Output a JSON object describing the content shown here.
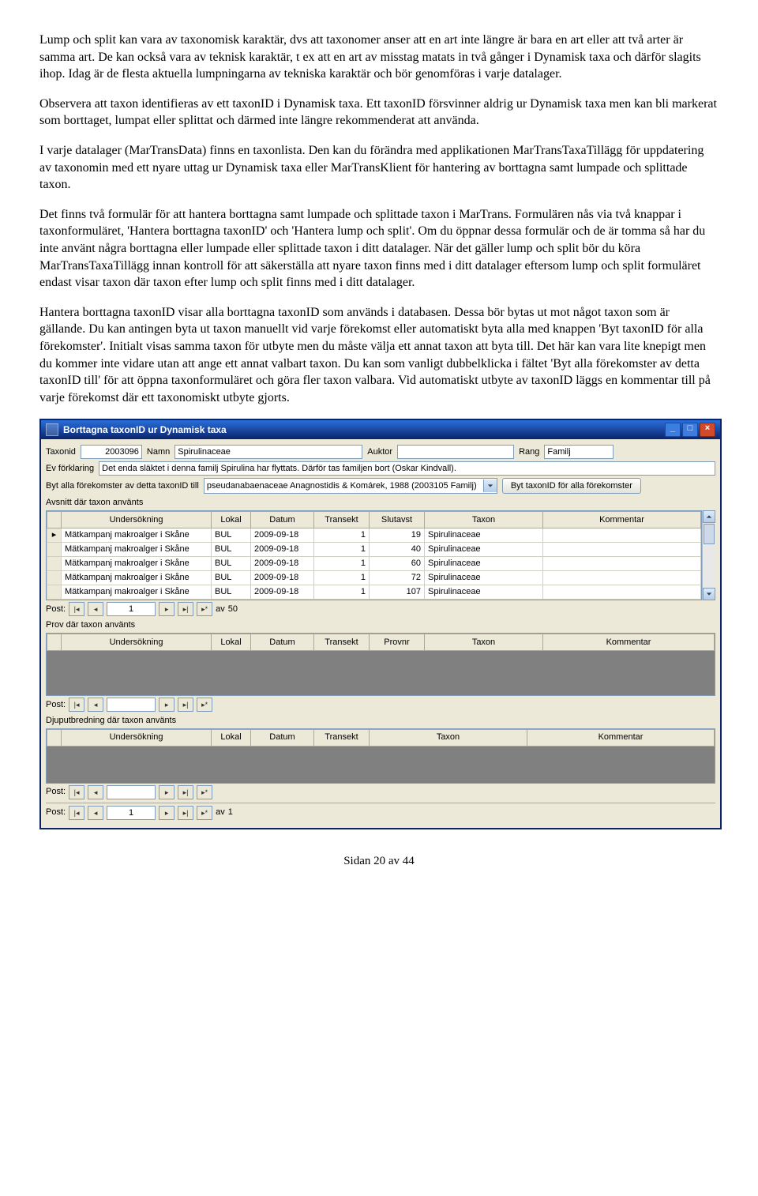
{
  "paragraphs": {
    "p1": "Lump och split kan vara av taxonomisk karaktär, dvs att taxonomer anser att en art inte längre är bara en art eller att två arter är samma art. De kan också vara av teknisk karaktär, t ex att en art av misstag matats in två gånger i Dynamisk taxa och därför slagits ihop. Idag är de flesta aktuella lumpningarna av tekniska karaktär och bör genomföras i varje datalager.",
    "p2": "Observera att taxon identifieras av ett taxonID i Dynamisk taxa. Ett taxonID försvinner aldrig ur Dynamisk taxa men kan bli markerat som borttaget, lumpat eller splittat och därmed inte längre rekommenderat att använda.",
    "p3": "I varje datalager (MarTransData) finns en taxonlista. Den kan du förändra med applikationen MarTransTaxaTillägg för uppdatering av taxonomin med ett nyare uttag ur Dynamisk taxa eller MarTransKlient för hantering av borttagna samt lumpade och splittade taxon.",
    "p4": "Det finns två formulär för att hantera borttagna samt lumpade och splittade taxon i MarTrans. Formulären nås via två knappar i taxonformuläret, 'Hantera borttagna taxonID' och 'Hantera lump och split'. Om du öppnar dessa formulär och de är tomma så har du inte använt några borttagna eller lumpade eller splittade taxon i ditt datalager. När det gäller lump och split bör du köra MarTransTaxaTillägg innan kontroll för att säkerställa att nyare taxon finns med i ditt datalager eftersom lump och split formuläret endast visar taxon där taxon efter lump och split finns med i ditt datalager.",
    "p5": "Hantera borttagna taxonID visar alla borttagna taxonID som används i databasen. Dessa bör bytas ut mot något taxon som är gällande. Du kan antingen byta ut taxon manuellt vid varje förekomst eller automatiskt byta alla med knappen 'Byt taxonID för alla förekomster'. Initialt visas samma taxon för utbyte men du måste välja ett annat taxon att byta till. Det här kan vara lite knepigt men du kommer inte vidare utan att ange ett annat valbart taxon. Du kan som vanligt dubbelklicka i fältet 'Byt alla förekomster av detta taxonID till' för att öppna taxonformuläret och göra fler taxon valbara. Vid automatiskt utbyte av taxonID läggs en kommentar till på varje förekomst där ett taxonomiskt utbyte gjorts."
  },
  "window": {
    "title": "Borttagna taxonID ur Dynamisk taxa",
    "labels": {
      "taxonid": "Taxonid",
      "namn": "Namn",
      "auktor": "Auktor",
      "rang": "Rang",
      "ev_forklaring": "Ev förklaring",
      "byt_alla": "Byt alla förekomster av detta taxonID till",
      "avsnitt": "Avsnitt där taxon använts",
      "prov": "Prov där taxon använts",
      "djup": "Djuputbredning där taxon använts",
      "post": "Post:",
      "av": "av"
    },
    "fields": {
      "taxonid": "2003096",
      "namn": "Spirulinaceae",
      "auktor": "",
      "rang": "Familj",
      "forklaring": "Det enda släktet i denna familj Spirulina har flyttats. Därför tas familjen bort (Oskar Kindvall).",
      "combo": "pseudanabaenaceae Anagnostidis & Komárek, 1988 (2003105 Familj)"
    },
    "buttons": {
      "byt": "Byt taxonID för alla förekomster"
    },
    "grid_avsnitt": {
      "headers": [
        "Undersökning",
        "Lokal",
        "Datum",
        "Transekt",
        "Slutavst",
        "Taxon",
        "Kommentar"
      ],
      "rows": [
        [
          "Mätkampanj makroalger i Skåne",
          "BUL",
          "2009-09-18",
          "1",
          "19",
          "Spirulinaceae",
          ""
        ],
        [
          "Mätkampanj makroalger i Skåne",
          "BUL",
          "2009-09-18",
          "1",
          "40",
          "Spirulinaceae",
          ""
        ],
        [
          "Mätkampanj makroalger i Skåne",
          "BUL",
          "2009-09-18",
          "1",
          "60",
          "Spirulinaceae",
          ""
        ],
        [
          "Mätkampanj makroalger i Skåne",
          "BUL",
          "2009-09-18",
          "1",
          "72",
          "Spirulinaceae",
          ""
        ],
        [
          "Mätkampanj makroalger i Skåne",
          "BUL",
          "2009-09-18",
          "1",
          "107",
          "Spirulinaceae",
          ""
        ]
      ],
      "total": "50"
    },
    "grid_prov": {
      "headers": [
        "Undersökning",
        "Lokal",
        "Datum",
        "Transekt",
        "Provnr",
        "Taxon",
        "Kommentar"
      ]
    },
    "grid_djup": {
      "headers": [
        "Undersökning",
        "Lokal",
        "Datum",
        "Transekt",
        "Taxon",
        "Kommentar"
      ]
    },
    "nav": {
      "pos": "1",
      "total_outer": "1"
    }
  },
  "footer": "Sidan 20 av 44"
}
